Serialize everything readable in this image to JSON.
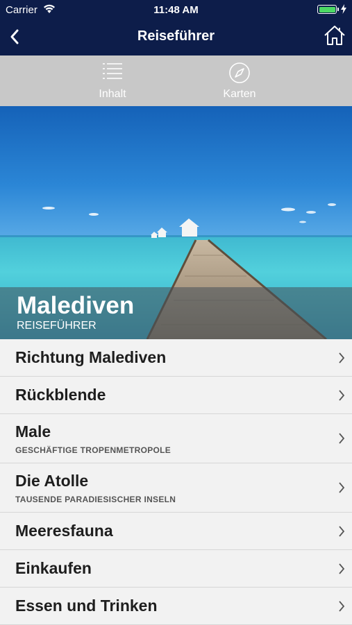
{
  "status": {
    "carrier": "Carrier",
    "time": "11:48 AM"
  },
  "nav": {
    "title": "Reiseführer",
    "back_icon": "chevron-left-icon",
    "home_icon": "house-icon"
  },
  "toolbar": {
    "items": [
      {
        "label": "Inhalt",
        "icon": "list-icon"
      },
      {
        "label": "Karten",
        "icon": "compass-icon"
      }
    ]
  },
  "hero": {
    "title": "Malediven",
    "subtitle": "REISEFÜHRER"
  },
  "list": [
    {
      "title": "Richtung Malediven",
      "subtitle": ""
    },
    {
      "title": "Rückblende",
      "subtitle": ""
    },
    {
      "title": "Male",
      "subtitle": "GESCHÄFTIGE TROPENMETROPOLE"
    },
    {
      "title": "Die Atolle",
      "subtitle": "TAUSENDE PARADIESISCHER INSELN"
    },
    {
      "title": "Meeresfauna",
      "subtitle": ""
    },
    {
      "title": "Einkaufen",
      "subtitle": ""
    },
    {
      "title": "Essen und Trinken",
      "subtitle": ""
    }
  ],
  "colors": {
    "nav_bg": "#0d1d4a",
    "toolbar_bg": "#c8c8c8",
    "list_bg": "#f2f2f2",
    "battery": "#4cd964"
  }
}
